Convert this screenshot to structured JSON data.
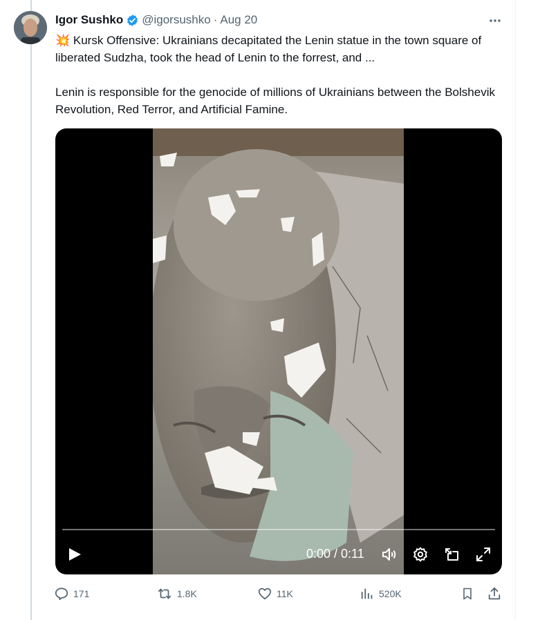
{
  "tweet": {
    "author_name": "Igor Sushko",
    "handle": "@igorsushko",
    "separator": "·",
    "date": "Aug 20",
    "text_line1": "💥 Kursk Offensive: Ukrainians decapitated the Lenin statue in the town square of liberated Sudzha, took the head of Lenin to the forrest, and ...",
    "text_line2": "Lenin is responsible for the genocide of millions of Ukrainians between the Bolshevik Revolution, Red Terror, and Artificial Famine."
  },
  "video": {
    "time_display": "0:00 / 0:11",
    "progress": 0
  },
  "actions": {
    "replies": "171",
    "reposts": "1.8K",
    "likes": "11K",
    "views": "520K"
  },
  "icons": [
    "verified-badge-icon",
    "more-icon",
    "play-icon",
    "volume-icon",
    "settings-icon",
    "pip-icon",
    "fullscreen-icon",
    "reply-icon",
    "repost-icon",
    "like-icon",
    "views-icon",
    "bookmark-icon",
    "share-icon"
  ],
  "colors": {
    "text": "#0f1419",
    "secondary": "#536471",
    "verified": "#1d9bf0",
    "thread_line": "#cfd9de"
  }
}
